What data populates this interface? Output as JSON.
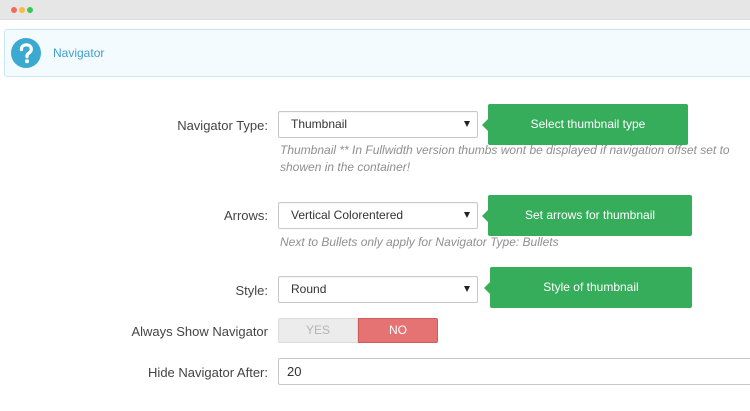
{
  "window": {
    "controls": [
      "close",
      "minimize",
      "maximize"
    ]
  },
  "panel": {
    "title": "Navigator",
    "icon": "help-question-icon",
    "accent_color": "#3ba9d0"
  },
  "fields": {
    "navigator_type": {
      "label": "Navigator Type:",
      "selected": "Thumbnail",
      "tooltip": "Select thumbnail type",
      "hint_line1": "Thumbnail ** In Fullwidth version thumbs wont be displayed if navigation offset set to",
      "hint_line2": "showen in the container!"
    },
    "arrows": {
      "label": "Arrows:",
      "selected": "Vertical Colorentered",
      "tooltip": "Set arrows for thumbnail",
      "hint": "Next to Bullets only apply for Navigator Type: Bullets"
    },
    "style": {
      "label": "Style:",
      "selected": "Round",
      "tooltip": "Style of thumbnail"
    },
    "always_show": {
      "label": "Always Show Navigator",
      "yes_label": "YES",
      "no_label": "NO",
      "value": "NO",
      "active_color": "#e57373"
    },
    "hide_after": {
      "label": "Hide Navigator After:",
      "value": "20"
    }
  },
  "colors": {
    "tooltip_bg": "#35ad5b",
    "header_bg": "#f4fbfe",
    "header_text": "#3f9fcf"
  }
}
